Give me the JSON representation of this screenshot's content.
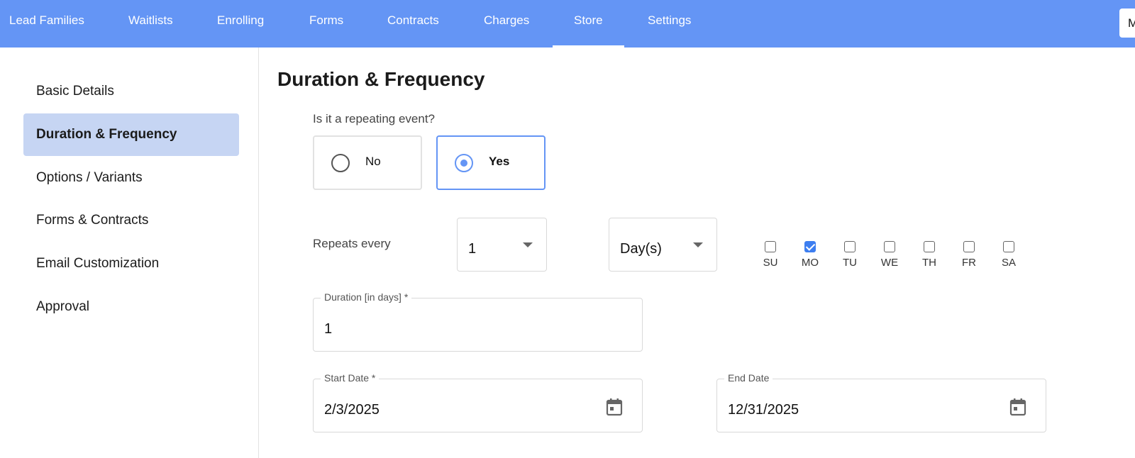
{
  "topnav": {
    "items": [
      {
        "label": "Lead Families"
      },
      {
        "label": "Waitlists"
      },
      {
        "label": "Enrolling"
      },
      {
        "label": "Forms"
      },
      {
        "label": "Contracts"
      },
      {
        "label": "Charges"
      },
      {
        "label": "Store",
        "active": true
      },
      {
        "label": "Settings"
      }
    ],
    "right_box_text": "M"
  },
  "sidebar": {
    "items": [
      {
        "label": "Basic Details"
      },
      {
        "label": "Duration & Frequency",
        "active": true
      },
      {
        "label": "Options / Variants"
      },
      {
        "label": "Forms & Contracts"
      },
      {
        "label": "Email Customization"
      },
      {
        "label": "Approval"
      }
    ]
  },
  "main": {
    "title": "Duration & Frequency",
    "repeating_question": "Is it a repeating event?",
    "repeating_options": [
      {
        "label": "No",
        "selected": false
      },
      {
        "label": "Yes",
        "selected": true
      }
    ],
    "repeats_every_label": "Repeats every",
    "repeat_interval": "1",
    "repeat_unit": "Day(s)",
    "days": [
      {
        "label": "SU",
        "checked": false
      },
      {
        "label": "MO",
        "checked": true
      },
      {
        "label": "TU",
        "checked": false
      },
      {
        "label": "WE",
        "checked": false
      },
      {
        "label": "TH",
        "checked": false
      },
      {
        "label": "FR",
        "checked": false
      },
      {
        "label": "SA",
        "checked": false
      }
    ],
    "duration": {
      "label": "Duration [in days] *",
      "value": "1"
    },
    "start_date": {
      "label": "Start Date *",
      "value": "2/3/2025"
    },
    "end_date": {
      "label": "End Date",
      "value": "12/31/2025"
    }
  },
  "colors": {
    "brand": "#6495f5",
    "sidebar_active": "#c6d5f3",
    "checkbox_checked": "#3d7ef0"
  },
  "icons": [
    "calendar-icon",
    "chevron-down-icon",
    "radio-icon",
    "checkbox-icon"
  ]
}
